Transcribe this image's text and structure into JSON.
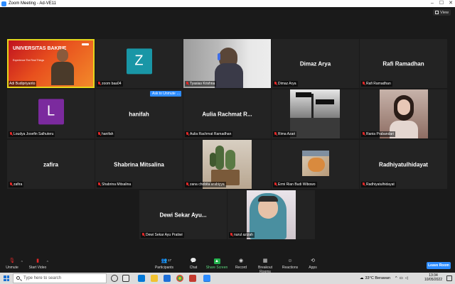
{
  "window": {
    "title": "Zoom Meeting - Ad-VE11"
  },
  "view_button": {
    "label": "View"
  },
  "tiles": [
    {
      "name": "Adi Budipriyanto",
      "kind": "slide",
      "speaking": true,
      "slide_title": "UNIVERSITAS BAKRIE",
      "slide_tag": "Experience The Real Things"
    },
    {
      "name": "zoom baa04",
      "kind": "avatar",
      "avatar_letter": "Z",
      "avatar_color": "#1996a6"
    },
    {
      "name": "Tyasias Krishna",
      "kind": "video-head"
    },
    {
      "name": "Dimaz Arya",
      "kind": "name",
      "center_name": "Dimaz Arya"
    },
    {
      "name": "Rafi Ramadhan",
      "kind": "name",
      "center_name": "Rafi Ramadhan"
    },
    {
      "name": "Loudya Josefin Salhuteru",
      "kind": "avatar",
      "avatar_letter": "L",
      "avatar_color": "#7b2a9e"
    },
    {
      "name": "hanifah",
      "kind": "name",
      "center_name": "hanifah"
    },
    {
      "name": "Aulia Rachmat Ramadhan",
      "kind": "name",
      "center_name": "Aulia Rachmat R..."
    },
    {
      "name": "Rima Azari",
      "kind": "photo-street"
    },
    {
      "name": "Rania Prabandari",
      "kind": "photo-portrait"
    },
    {
      "name": "zafira",
      "kind": "name",
      "center_name": "zafira"
    },
    {
      "name": "Shabrina Mitsalina",
      "kind": "name",
      "center_name": "Shabrina Mitsalina"
    },
    {
      "name": "zana chobita arabiyya",
      "kind": "photo-cactus"
    },
    {
      "name": "Ermi Rian Budi Wibowo",
      "kind": "photo-cat"
    },
    {
      "name": "Radhiyatulhidayat",
      "kind": "name",
      "center_name": "Radhiyatulhidayat"
    },
    {
      "name": "Dewi Sekar Ayu Pratiwi",
      "kind": "name",
      "center_name": "Dewi Sekar Ayu..."
    },
    {
      "name": "nurul azizah",
      "kind": "photo-hijab"
    }
  ],
  "unmute_popup": {
    "label": "Ask to Unmute",
    "more": "..."
  },
  "toolbar": {
    "unmute": "Unmute",
    "start_video": "Start Video",
    "participants": "Participants",
    "participants_count": "17",
    "chat": "Chat",
    "share_screen": "Share Screen",
    "record": "Record",
    "breakout": "Breakout Rooms",
    "reactions": "Reactions",
    "apps": "Apps",
    "leave": "Leave Room"
  },
  "taskbar": {
    "search_placeholder": "Type here to search",
    "weather": "33°C  Berawan",
    "time": "13:34",
    "date": "10/05/2022"
  }
}
